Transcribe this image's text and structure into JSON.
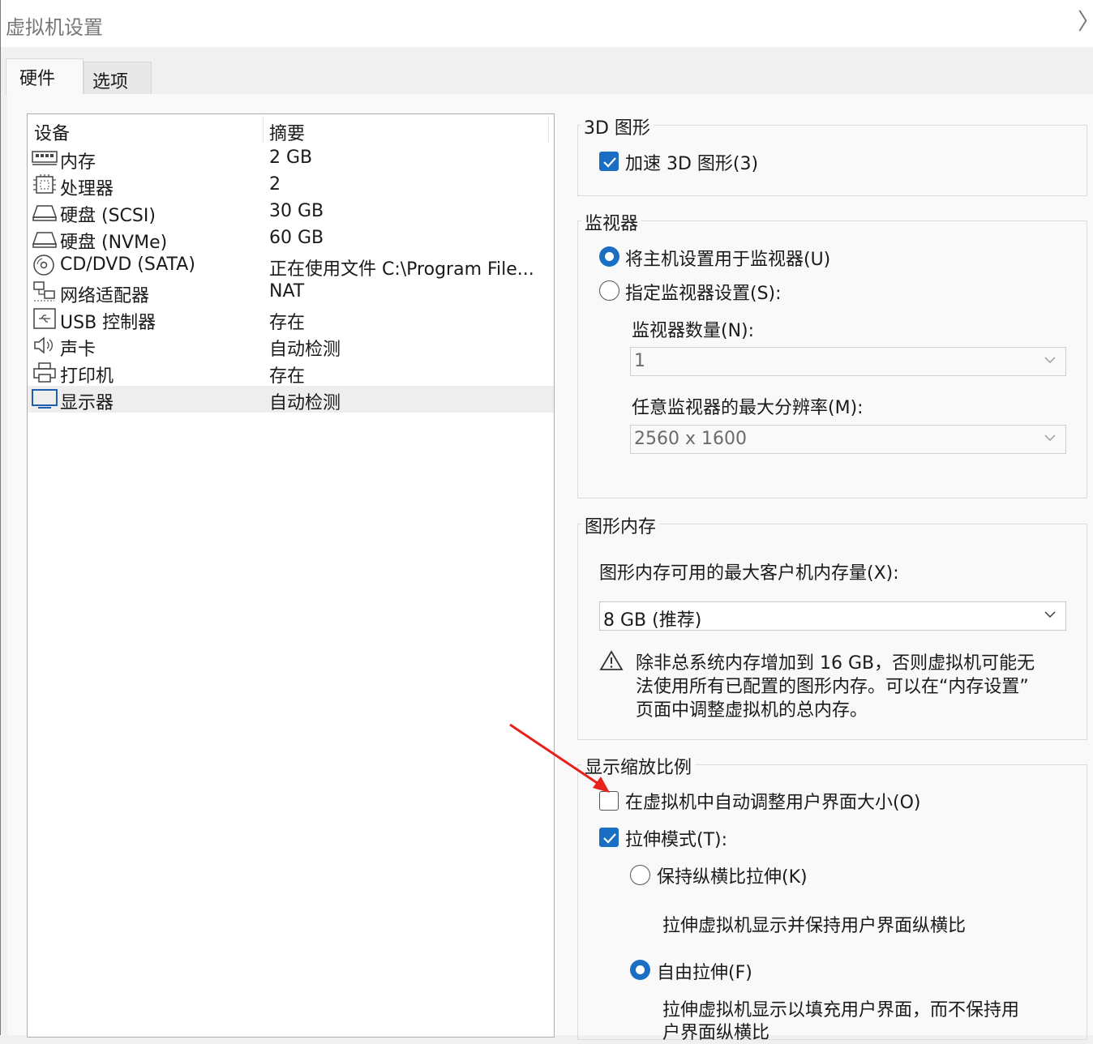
{
  "window": {
    "title": "虚拟机设置",
    "close_glyph": "〉"
  },
  "tabs": [
    {
      "label": "硬件"
    },
    {
      "label": "选项"
    }
  ],
  "devices": {
    "col_device": "设备",
    "col_summary": "摘要",
    "rows": [
      {
        "name": "内存",
        "value": "2 GB",
        "icon": "memory-icon"
      },
      {
        "name": "处理器",
        "value": "2",
        "icon": "processor-icon"
      },
      {
        "name": "硬盘 (SCSI)",
        "value": "30 GB",
        "icon": "hard-disk-icon"
      },
      {
        "name": "硬盘 (NVMe)",
        "value": "60 GB",
        "icon": "hard-disk-icon"
      },
      {
        "name": "CD/DVD (SATA)",
        "value": "正在使用文件 C:\\Program File...",
        "icon": "cd-dvd-icon"
      },
      {
        "name": "网络适配器",
        "value": "NAT",
        "icon": "network-adapter-icon"
      },
      {
        "name": "USB 控制器",
        "value": "存在",
        "icon": "usb-icon"
      },
      {
        "name": "声卡",
        "value": "自动检测",
        "icon": "speaker-icon"
      },
      {
        "name": "打印机",
        "value": "存在",
        "icon": "printer-icon"
      },
      {
        "name": "显示器",
        "value": "自动检测",
        "icon": "monitor-icon",
        "selected": true
      }
    ]
  },
  "graphics3d": {
    "title": "3D 图形",
    "accelerate_label": "加速 3D 图形(3)",
    "accelerate_checked": true
  },
  "monitors": {
    "title": "监视器",
    "use_host_label": "将主机设置用于监视器(U)",
    "specify_label": "指定监视器设置(S):",
    "selected": "use_host",
    "count_label": "监视器数量(N):",
    "count_value": "1",
    "maxres_label": "任意监视器的最大分辨率(M):",
    "maxres_value": "2560 x 1600"
  },
  "graphics_memory": {
    "title": "图形内存",
    "max_label": "图形内存可用的最大客户机内存量(X):",
    "value": "8 GB (推荐)",
    "warning_lines": [
      "除非总系统内存增加到 16 GB，否则虚拟机可能无",
      "法使用所有已配置的图形内存。可以在“内存设置”",
      "页面中调整虚拟机的总内存。"
    ]
  },
  "display_scaling": {
    "title": "显示缩放比例",
    "autofit_label": "在虚拟机中自动调整用户界面大小(O)",
    "autofit_checked": false,
    "stretch_label": "拉伸模式(T):",
    "stretch_checked": true,
    "keep_aspect_label": "保持纵横比拉伸(K)",
    "keep_aspect_desc": "拉伸虚拟机显示并保持用户界面纵横比",
    "free_label": "自由拉伸(F)",
    "free_desc_lines": [
      "拉伸虚拟机显示以填充用户界面，而不保持用",
      "户界面纵横比"
    ],
    "selected": "free"
  },
  "colors": {
    "accent": "#1a6fc4",
    "arrow": "#e8221b"
  }
}
